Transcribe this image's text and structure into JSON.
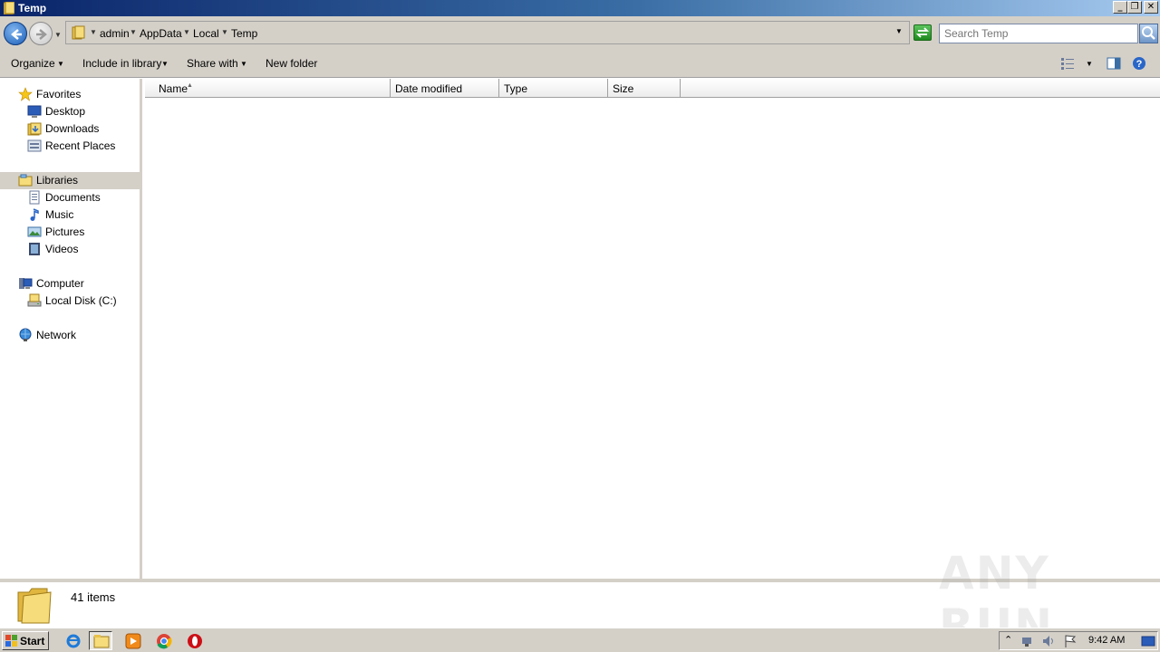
{
  "window": {
    "title": "Temp"
  },
  "address": {
    "crumbs": [
      "admin",
      "AppData",
      "Local",
      "Temp"
    ],
    "search_placeholder": "Search Temp"
  },
  "toolbar": {
    "organize": "Organize",
    "include_in_library": "Include in library",
    "share_with": "Share with",
    "new_folder": "New folder"
  },
  "nav": {
    "favorites": "Favorites",
    "desktop": "Desktop",
    "downloads": "Downloads",
    "recent_places": "Recent Places",
    "libraries": "Libraries",
    "documents": "Documents",
    "music": "Music",
    "pictures": "Pictures",
    "videos": "Videos",
    "computer": "Computer",
    "local_disk": "Local Disk (C:)",
    "network": "Network"
  },
  "columns": {
    "name": "Name",
    "date_modified": "Date modified",
    "type": "Type",
    "size": "Size"
  },
  "details": {
    "item_count": "41 items"
  },
  "watermark": "ANY RUN",
  "taskbar": {
    "start": "Start",
    "clock": "9:42 AM"
  },
  "colors": {
    "title_gradient_start": "#0a246a",
    "chrome": "#d4d0c8",
    "accent_blue": "#1c5fb8"
  }
}
